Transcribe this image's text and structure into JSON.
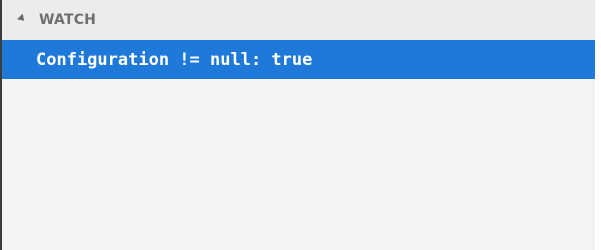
{
  "watch": {
    "title": "WATCH",
    "items": [
      {
        "expression": "Configuration != null",
        "separator": ": ",
        "value": "true"
      }
    ]
  },
  "colors": {
    "selection": "#1f79d9",
    "panel_background": "#f3f3f3",
    "header_background": "#ececec"
  },
  "icons": {
    "collapse": "chevron-down-icon"
  }
}
